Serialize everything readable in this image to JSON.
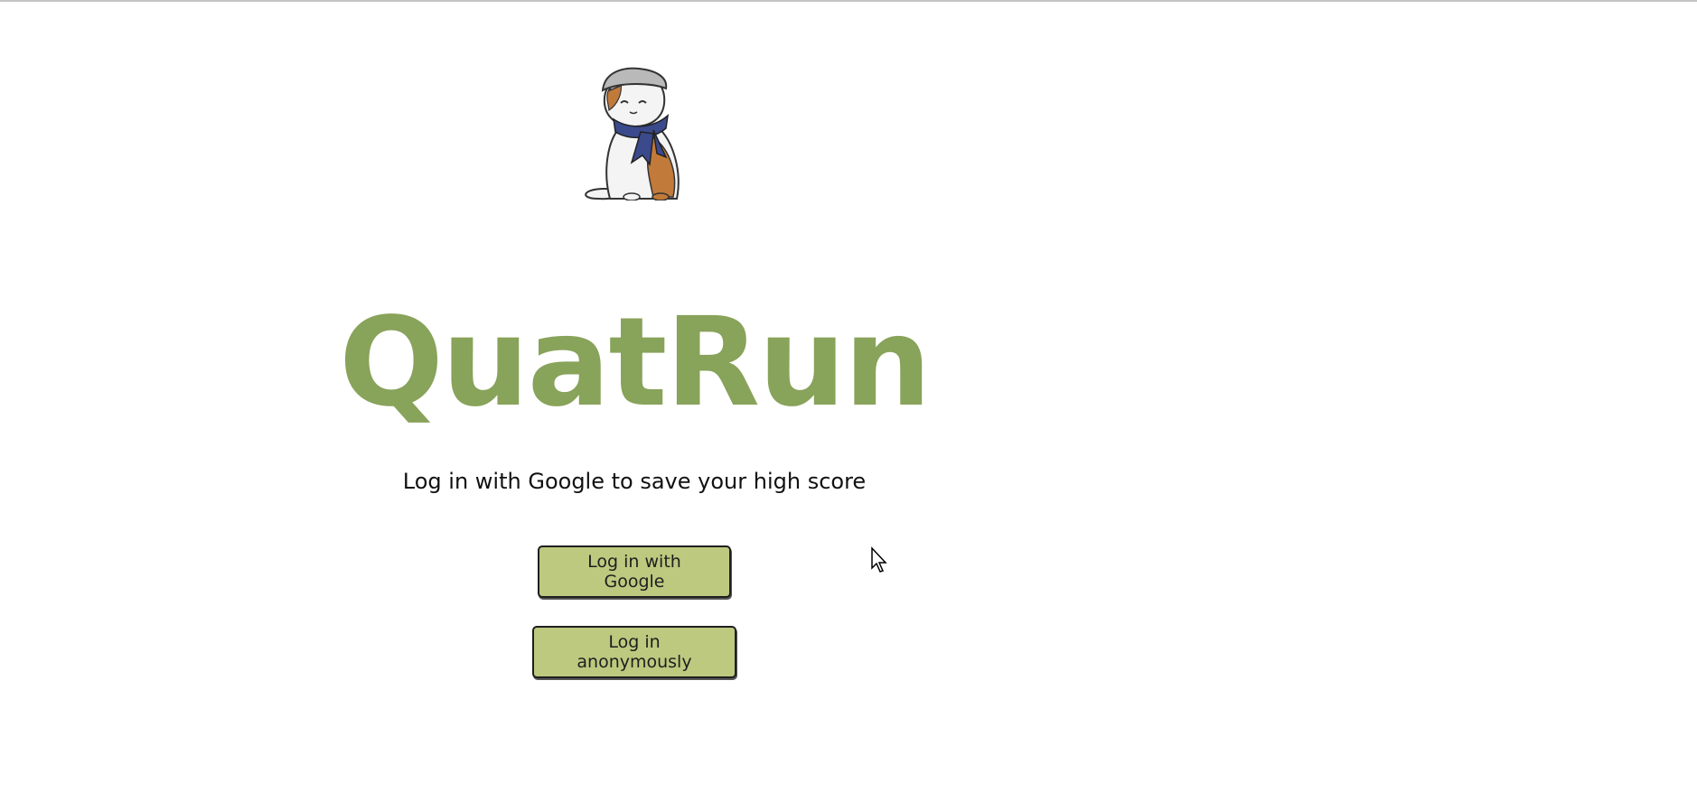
{
  "app": {
    "title": "QuatRun",
    "subtitle": "Log in with Google to save your high score"
  },
  "buttons": {
    "google_label": "Log in with Google",
    "anonymous_label": "Log in anonymously"
  },
  "mascot": {
    "icon": "cat-mascot-with-cap-and-scarf"
  },
  "colors": {
    "title": "#88a35a",
    "button_bg": "#bdc97f",
    "button_border": "#1e1e1e",
    "scarf": "#3b4a8c",
    "cat_patch": "#c27a3a"
  }
}
